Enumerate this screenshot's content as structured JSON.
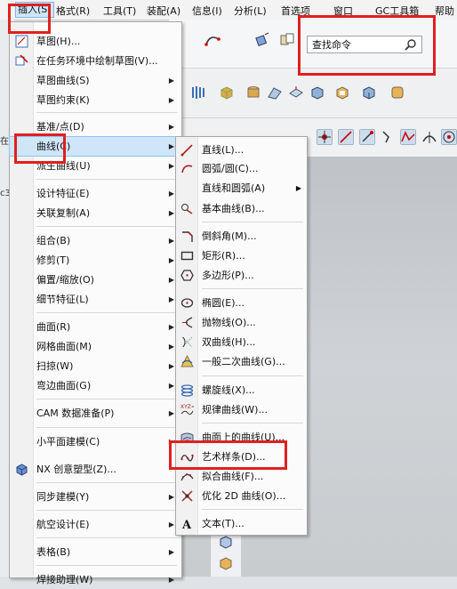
{
  "menubar": {
    "items": [
      "插入(S)",
      "格式(R)",
      "工具(T)",
      "装配(A)",
      "信息(I)",
      "分析(L)",
      "首选项",
      "窗口",
      "GC工具箱",
      "帮助"
    ]
  },
  "search": {
    "placeholder": "查找命令"
  },
  "left_strip": {
    "labels": [
      "在",
      "c3"
    ]
  },
  "insert_menu": {
    "items": [
      {
        "label": "草图(H)..."
      },
      {
        "label": "在任务环境中绘制草图(V)..."
      },
      {
        "label": "草图曲线(S)"
      },
      {
        "label": "草图约束(K)"
      },
      {
        "label": "基准/点(D)"
      },
      {
        "label": "曲线(C)"
      },
      {
        "label": "派生曲线(U)"
      },
      {
        "label": "设计特征(E)"
      },
      {
        "label": "关联复制(A)"
      },
      {
        "label": "组合(B)"
      },
      {
        "label": "修剪(T)"
      },
      {
        "label": "偏置/缩放(O)"
      },
      {
        "label": "细节特征(L)"
      },
      {
        "label": "曲面(R)"
      },
      {
        "label": "网格曲面(M)"
      },
      {
        "label": "扫掠(W)"
      },
      {
        "label": "弯边曲面(G)"
      },
      {
        "label": "CAM 数据准备(P)"
      },
      {
        "label": "小平面建模(C)"
      },
      {
        "label": "NX 创意塑型(Z)..."
      },
      {
        "label": "同步建模(Y)"
      },
      {
        "label": "航空设计(E)"
      },
      {
        "label": "表格(B)"
      },
      {
        "label": "焊接助理(W)"
      }
    ]
  },
  "curve_submenu": {
    "items": [
      {
        "label": "直线(L)..."
      },
      {
        "label": "圆弧/圆(C)..."
      },
      {
        "label": "直线和圆弧(A)"
      },
      {
        "label": "基本曲线(B)..."
      },
      {
        "label": "倒斜角(M)..."
      },
      {
        "label": "矩形(R)..."
      },
      {
        "label": "多边形(P)..."
      },
      {
        "label": "椭圆(E)..."
      },
      {
        "label": "抛物线(O)..."
      },
      {
        "label": "双曲线(H)..."
      },
      {
        "label": "一般二次曲线(G)..."
      },
      {
        "label": "螺旋线(X)..."
      },
      {
        "label": "规律曲线(W)..."
      },
      {
        "label": "曲面上的曲线(U)..."
      },
      {
        "label": "艺术样条(D)..."
      },
      {
        "label": "拟合曲线(F)..."
      },
      {
        "label": "优化 2D 曲线(O)..."
      },
      {
        "label": "文本(T)..."
      }
    ]
  },
  "colors": {
    "highlight_box": "#e02020",
    "hover": "#cfe6f8"
  }
}
